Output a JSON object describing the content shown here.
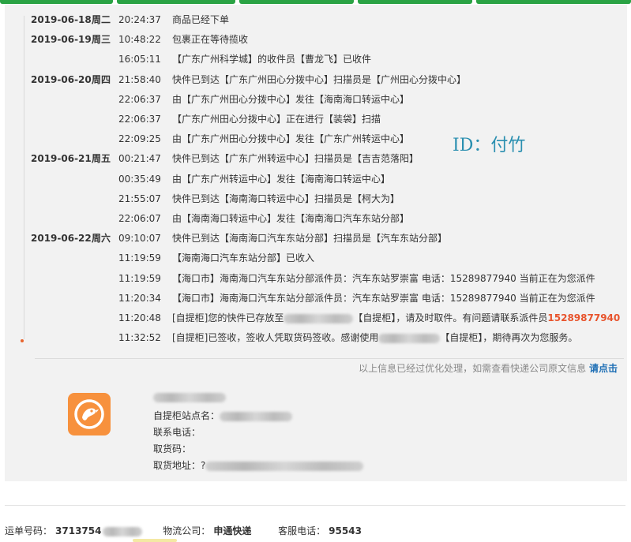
{
  "colors": {
    "accent_green": "#2aa344",
    "highlight": "#e8542d",
    "link": "#1e6fb5",
    "watermark": "#2a8fb0",
    "logo_bg": "#f7913d"
  },
  "watermark": "ID：付竹",
  "events": [
    {
      "date": "2019-06-18",
      "week": "周二",
      "time": "20:24:37",
      "parts": [
        {
          "t": "商品已经下单"
        }
      ]
    },
    {
      "date": "2019-06-19",
      "week": "周三",
      "time": "10:48:22",
      "parts": [
        {
          "t": "包裹正在等待揽收"
        }
      ]
    },
    {
      "date": "",
      "week": "",
      "time": "16:05:11",
      "parts": [
        {
          "t": "【广东广州科学城】的收件员【曹龙飞】已收件"
        }
      ]
    },
    {
      "date": "2019-06-20",
      "week": "周四",
      "time": "21:58:40",
      "parts": [
        {
          "t": "快件已到达【广东广州田心分拨中心】扫描员是【广州田心分拨中心】"
        }
      ]
    },
    {
      "date": "",
      "week": "",
      "time": "22:06:37",
      "parts": [
        {
          "t": "由【广东广州田心分拨中心】发往【海南海口转运中心】"
        }
      ]
    },
    {
      "date": "",
      "week": "",
      "time": "22:06:37",
      "parts": [
        {
          "t": "【广东广州田心分拨中心】正在进行【装袋】扫描"
        }
      ]
    },
    {
      "date": "",
      "week": "",
      "time": "22:09:25",
      "parts": [
        {
          "t": "由【广东广州田心分拨中心】发往【广东广州转运中心】"
        }
      ]
    },
    {
      "date": "2019-06-21",
      "week": "周五",
      "time": "00:21:47",
      "parts": [
        {
          "t": "快件已到达【广东广州转运中心】扫描员是【吉吉范落阳】"
        }
      ]
    },
    {
      "date": "",
      "week": "",
      "time": "00:35:49",
      "parts": [
        {
          "t": "由【广东广州转运中心】发往【海南海口转运中心】"
        }
      ]
    },
    {
      "date": "",
      "week": "",
      "time": "21:55:07",
      "parts": [
        {
          "t": "快件已到达【海南海口转运中心】扫描员是【柯大为】"
        }
      ]
    },
    {
      "date": "",
      "week": "",
      "time": "22:06:07",
      "parts": [
        {
          "t": "由【海南海口转运中心】发往【海南海口汽车东站分部】"
        }
      ]
    },
    {
      "date": "2019-06-22",
      "week": "周六",
      "time": "09:10:07",
      "parts": [
        {
          "t": "快件已到达【海南海口汽车东站分部】扫描员是【汽车东站分部】"
        }
      ]
    },
    {
      "date": "",
      "week": "",
      "time": "11:19:59",
      "parts": [
        {
          "t": "【海南海口汽车东站分部】已收入"
        }
      ]
    },
    {
      "date": "",
      "week": "",
      "time": "11:19:59",
      "parts": [
        {
          "t": "【海口市】海南海口汽车东站分部派件员：汽车东站罗崇富 电话：15289877940 当前正在为您派件"
        }
      ]
    },
    {
      "date": "",
      "week": "",
      "time": "11:20:34",
      "parts": [
        {
          "t": "【海口市】海南海口汽车东站分部派件员：汽车东站罗崇富 电话：15289877940 当前正在为您派件"
        }
      ]
    },
    {
      "date": "",
      "week": "",
      "time": "11:20:48",
      "parts": [
        {
          "t": "[自提柜]您的快件已存放至"
        },
        {
          "blur": 88
        },
        {
          "t": "【自提柜】，请及时取件。有问题请联系派件员"
        },
        {
          "t": "15289877940",
          "hl": true
        }
      ]
    },
    {
      "date": "",
      "week": "",
      "time": "11:32:52",
      "parts": [
        {
          "t": "[自提柜]已签收，签收人凭取货码签收。感谢使用"
        },
        {
          "blur": 78
        },
        {
          "t": "【自提柜】，期待再次为您服务。"
        }
      ]
    }
  ],
  "notice": {
    "text": "以上信息已经过优化处理，如需查看快递公司原文信息 ",
    "link": "请点击"
  },
  "locker": {
    "site_label": "自提柜站点名：",
    "phone_label": "联系电话：",
    "code_label": "取货码：",
    "addr_label": "取货地址：",
    "addr_prefix": "?"
  },
  "footer": {
    "waybill_label": "运单号码：",
    "waybill_value": "3713754",
    "company_label": "物流公司：",
    "company_value": "申通快递",
    "service_label": "客服电话：",
    "service_value": "95543"
  }
}
